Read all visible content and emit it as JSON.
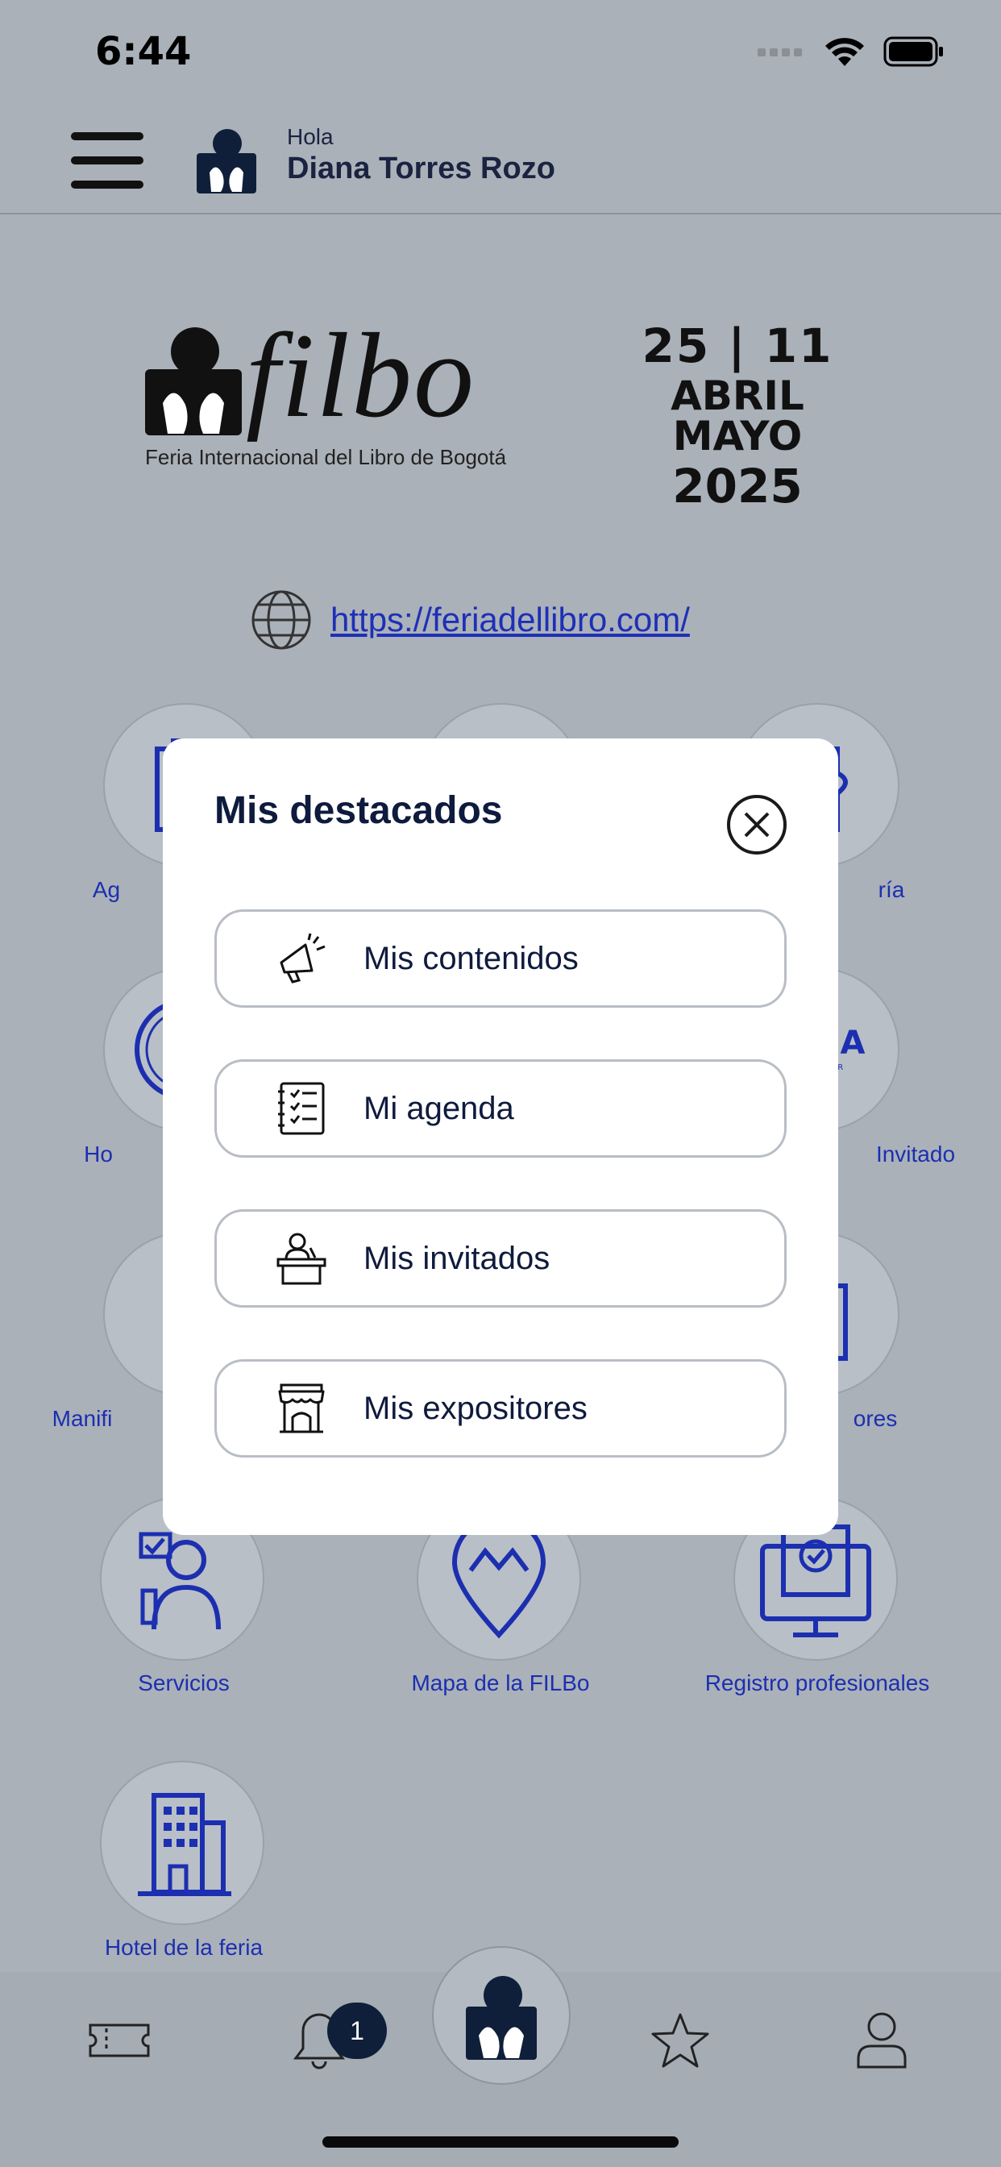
{
  "status_bar": {
    "time": "6:44"
  },
  "header": {
    "greeting": "Hola",
    "user_name": "Diana Torres Rozo"
  },
  "logo": {
    "brand": "filbo",
    "subtitle": "Feria Internacional del Libro de Bogotá",
    "dates_line1": "25 | 11",
    "dates_line2": "ABRIL MAYO",
    "dates_line3": "2025"
  },
  "website": {
    "url": "https://feriadellibro.com/"
  },
  "grid": {
    "labels": [
      "Ag",
      "ría",
      "Ho",
      "Invitado",
      "Manifi",
      "ores",
      "Servicios",
      "Mapa de la FILBo",
      "Registro profesionales",
      "Hotel de la feria"
    ]
  },
  "modal": {
    "title": "Mis destacados",
    "items": [
      {
        "label": "Mis contenidos",
        "icon": "megaphone-icon"
      },
      {
        "label": "Mi agenda",
        "icon": "checklist-notebook-icon"
      },
      {
        "label": "Mis invitados",
        "icon": "speaker-podium-icon"
      },
      {
        "label": "Mis expositores",
        "icon": "market-stall-icon"
      }
    ]
  },
  "bottom_nav": {
    "notification_count": "1",
    "items": [
      "ticket-icon",
      "bell-icon",
      "filbo-home-icon",
      "star-icon",
      "user-icon"
    ]
  },
  "colors": {
    "accent": "#1c2fb0",
    "dark": "#0f1b3d",
    "overlay_bg": "#aab1b9"
  }
}
